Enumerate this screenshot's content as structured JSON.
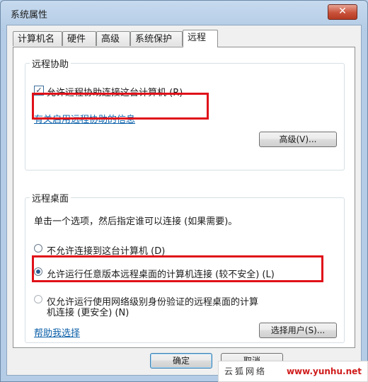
{
  "window": {
    "title": "系统属性",
    "close_glyph": "✕"
  },
  "tabs": [
    {
      "label": "计算机名",
      "active": false
    },
    {
      "label": "硬件",
      "active": false
    },
    {
      "label": "高级",
      "active": false
    },
    {
      "label": "系统保护",
      "active": false
    },
    {
      "label": "远程",
      "active": true
    }
  ],
  "remote_assistance": {
    "group_label": "远程协助",
    "checkbox_label": "允许远程协助连接这台计算机 (R)",
    "checkbox_checked": true,
    "info_link": "有关启用远程协助的信息",
    "advanced_button": "高级(V)..."
  },
  "remote_desktop": {
    "group_label": "远程桌面",
    "instruction": "单击一个选项，然后指定谁可以连接 (如果需要)。",
    "options": [
      {
        "label": "不允许连接到这台计算机 (D)",
        "selected": false
      },
      {
        "label": "允许运行任意版本远程桌面的计算机连接 (较不安全) (L)",
        "selected": true
      },
      {
        "label_line1": "仅允许运行使用网络级别身份验证的远程桌面的计算",
        "label_line2": "机连接 (更安全) (N)",
        "selected": false,
        "disabled": true
      }
    ],
    "help_link": "帮助我选择",
    "select_users_button": "选择用户(S)..."
  },
  "footer": {
    "ok_button": "确定",
    "cancel_button": "取消"
  },
  "watermark": {
    "text": "云狐网络",
    "url": "www.yunhu.net"
  },
  "colors": {
    "highlight": "#e01019",
    "link": "#0b5fa8"
  },
  "icons": {
    "checkbox_check": "✓"
  }
}
